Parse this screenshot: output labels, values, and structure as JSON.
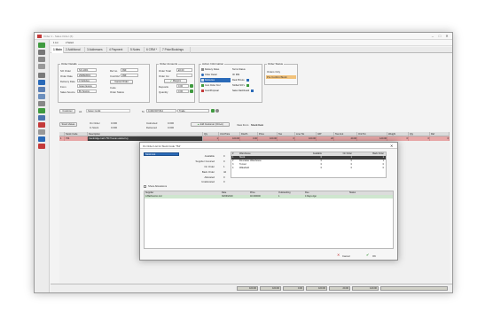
{
  "window": {
    "title": "Order 1 - Sales Order (6)",
    "controls": [
      "–",
      "□",
      "✕"
    ]
  },
  "menubar": {
    "items": [
      "1 Lst",
      "2 Select"
    ]
  },
  "tabs": [
    {
      "label": "1 Main",
      "active": true
    },
    {
      "label": "2 Additional",
      "active": false
    },
    {
      "label": "3 Addresses",
      "active": false
    },
    {
      "label": "4 Payment",
      "active": false
    },
    {
      "label": "5 Notes",
      "active": false
    },
    {
      "label": "6 CRM *",
      "active": false
    },
    {
      "label": "7 Price/Bookings",
      "active": false
    }
  ],
  "order_details": {
    "title": "Order Details",
    "order_no_label": "SO Order",
    "order_no": "SO-1001",
    "order_date_label": "Order Date",
    "order_date": "29/08/2019",
    "delivery_label": "Delivery Date",
    "delivery": "3 Vehicles",
    "from_label": "From",
    "from": "Gwen Evans",
    "sales_source_label": "Sales Source",
    "sales_source": "By Source",
    "ref_label": "Ref no.",
    "ref": "999",
    "cust_ref_label": "Cust Ref",
    "cust_ref": "999",
    "cancel_btn": "Cancel Order",
    "code_label": "Code",
    "status_label": "Order Status"
  },
  "order_amounts": {
    "title": "Order Amounts",
    "rows": [
      {
        "label": "Order Total",
        "value": "£0.00"
      },
      {
        "label": "Order Inv",
        "value": ""
      }
    ],
    "margins_btn": "Margins",
    "rows2": [
      {
        "label": "Deposits",
        "value": "0.00"
      },
      {
        "label": "Quantity",
        "value": "0.00"
      }
    ]
  },
  "actions": {
    "title": "Action Information",
    "left": [
      "Delivery Notes",
      "Order Detail",
      "Deliveries",
      "Cust Order Xref",
      "Cust/Proposal"
    ],
    "right": [
      "Terms Status",
      "ID: 999",
      "Deal Picture",
      "Telified SO's",
      "Sales Dashboard"
    ]
  },
  "order_status": {
    "title": "Order Status",
    "items": [
      "Orders Only",
      "Pre Confirm/Stock"
    ]
  },
  "customer_bar": {
    "customer_label": "Customer",
    "customer_id": "A1",
    "customer_name": "Karen Certik",
    "to_label": "To",
    "to_value": "0-300-507 814",
    "trade_label": "Trade"
  },
  "stock_bar": {
    "stock_values_btn": "Stock Values",
    "on_order_label": "On Order",
    "on_order": "0.000",
    "in_stock_label": "In Stock",
    "in_stock": "0.000",
    "instructed_label": "Instructed",
    "instructed": "0.000",
    "delivered_label": "Delivered",
    "delivered": "0.000",
    "add_btn": "Add Customer (Ctrl+A)",
    "view_label": "View From",
    "view_value": "Stock Item"
  },
  "grid": {
    "headers": [
      "",
      "Stock Code",
      "Description",
      "Qty",
      "Unit Price",
      "Disc%",
      "Price",
      "Tax",
      "Line Tot",
      "VAT",
      "Tax Amt",
      "Ord Tot",
      "Weight",
      "Qty",
      "Ref"
    ],
    "row": [
      "1",
      "764",
      "Cambridge bath 750 Tuscan walnut lvy",
      "1",
      "100.00",
      "0.00",
      "100.00",
      "0",
      "100.00",
      "20",
      "40.00",
      "120.00",
      "0",
      "0",
      "0"
    ]
  },
  "modal": {
    "title": "On Order List for Stock Code '764'",
    "close": "✕",
    "location_select": "Stock List",
    "stats": [
      {
        "label": "Available",
        "value": "0"
      },
      {
        "label": "Supplier Invoiced",
        "value": "0"
      },
      {
        "label": "On Order",
        "value": "1"
      },
      {
        "label": "Back Order",
        "value": "42"
      },
      {
        "label": "Allocated",
        "value": "0"
      },
      {
        "label": "Unallocated",
        "value": "0"
      }
    ],
    "checkbox_label": "Show Allocations",
    "wh_headers": [
      "#",
      "Warehouse",
      "Available",
      "On Order",
      "Back Order"
    ],
    "wh_rows": [
      [
        "1",
        "Stock",
        "0",
        "1",
        "1"
      ],
      [
        "2",
        "Doncaster Warehouse",
        "0",
        "0",
        "1"
      ],
      [
        "3",
        "Tunnel",
        "0",
        "0",
        "0"
      ],
      [
        "4",
        "Wakefield",
        "0",
        "0",
        "0"
      ]
    ],
    "list_headers": [
      "Supplier",
      "Date",
      "Price",
      "Outstanding",
      "Due",
      "Status"
    ],
    "list_rows": [
      [
        "A Bathrooms Ltd",
        "30/09/2019",
        "40.000000",
        "1",
        "4 Days Ago",
        ""
      ]
    ],
    "cancel_btn": "Cancel",
    "ok_btn": "OK"
  },
  "totals": [
    "100.00",
    "100.00",
    "0.00",
    "100.00",
    "20.00",
    "120.00"
  ],
  "colors": {
    "accent": "#2a6ab8",
    "row_highlight": "#e7a7a7",
    "selected_row": "#3c3c3c",
    "icon_red": "#c43a3a",
    "icon_green": "#3f9a3f"
  }
}
